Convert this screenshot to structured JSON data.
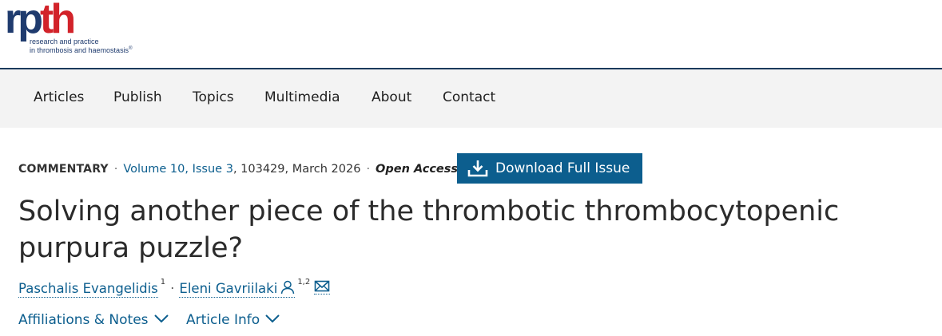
{
  "logo": {
    "wordmark_part1": "rp",
    "wordmark_part2": "th",
    "tagline_line1": "research and practice",
    "tagline_line2": "in thrombosis and haemostasis",
    "registered_mark": "®",
    "colors": {
      "rp": "#1f3b6e",
      "th": "#d2232a"
    }
  },
  "nav": {
    "items": [
      {
        "label": "Articles"
      },
      {
        "label": "Publish"
      },
      {
        "label": "Topics"
      },
      {
        "label": "Multimedia"
      },
      {
        "label": "About"
      },
      {
        "label": "Contact"
      }
    ]
  },
  "article_meta": {
    "type": "COMMENTARY",
    "separator": "·",
    "volume_issue": "Volume 10, Issue 3",
    "article_number": ", 103429, March 2026",
    "access": "Open Access"
  },
  "download_button": {
    "label": "Download Full Issue",
    "icon": "download-icon",
    "color": "#0c5e8e"
  },
  "article": {
    "title": "Solving another piece of the thrombotic thrombocytopenic purpura puzzle?"
  },
  "authors": [
    {
      "name": "Paschalis Evangelidis",
      "affil": "1"
    },
    {
      "name": "Eleni Gavriilaki",
      "affil": "1,2",
      "icons": [
        "person-icon",
        "mail-icon"
      ]
    }
  ],
  "toggles": {
    "affiliations_label": "Affiliations & Notes",
    "article_info_label": "Article Info"
  },
  "colors": {
    "link": "#0c5e8e",
    "nav_bg": "#f3f3f3",
    "header_rule": "#1b3a5c"
  }
}
